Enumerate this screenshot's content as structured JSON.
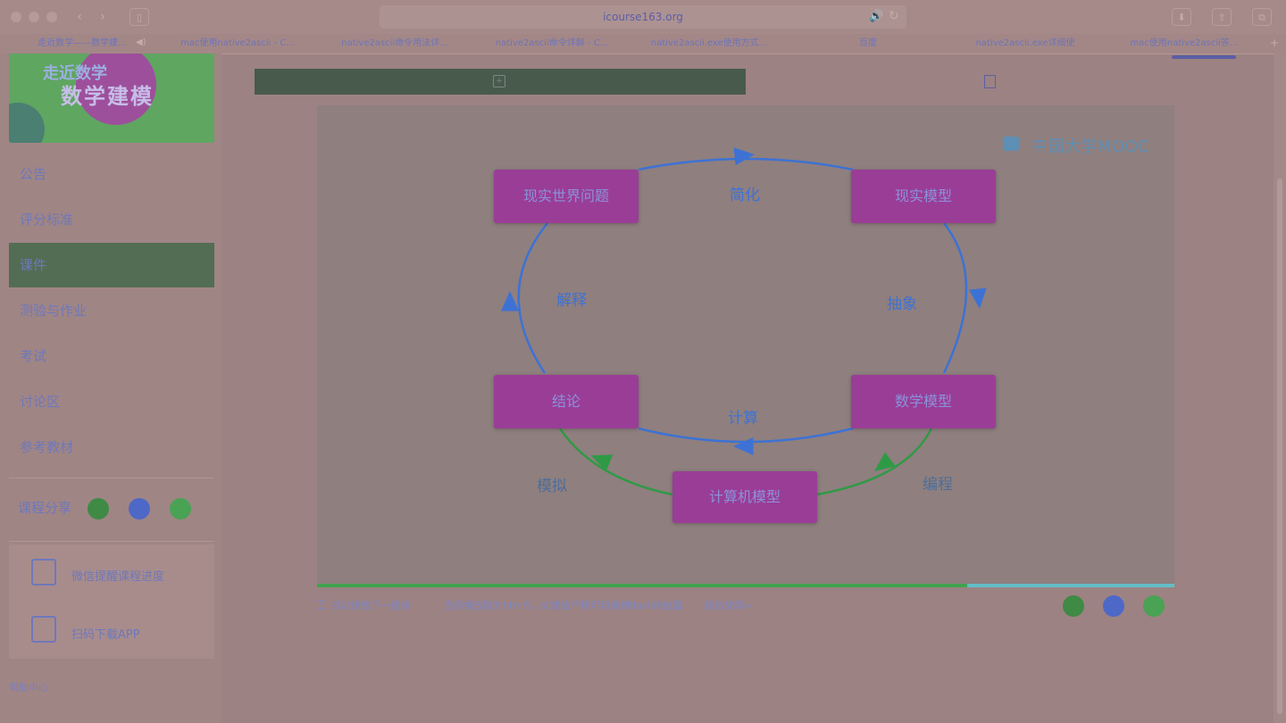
{
  "browser": {
    "url": "icourse163.org",
    "tab_buttons": [
      "‹",
      "›"
    ],
    "bookmarks": [
      "走近数学——数学建...",
      "mac使用native2ascii - C...",
      "native2ascii命令用法详...",
      "native2ascii命令详解 - C...",
      "native2ascii.exe使用方式...",
      "百度",
      "native2ascii.exe详细使",
      "mac使用native2ascii答..."
    ]
  },
  "sidebar": {
    "banner_line1": "走近数学",
    "banner_line2": "数学建模",
    "nav": [
      {
        "label": "公告"
      },
      {
        "label": "评分标准"
      },
      {
        "label": "课件"
      },
      {
        "label": "测验与作业"
      },
      {
        "label": "考试"
      },
      {
        "label": "讨论区"
      },
      {
        "label": "参考教材"
      }
    ],
    "active_index": 2,
    "share_label": "课程分享",
    "app_rows": [
      {
        "label": "微信提醒课程进度"
      },
      {
        "label": "扫码下载APP"
      }
    ],
    "help": "帮助中心"
  },
  "video": {
    "watermark": "中国大学MOOC",
    "progress": 0.758,
    "diagram": {
      "nodes": [
        {
          "label": "现实世界问题"
        },
        {
          "label": "现实模型"
        },
        {
          "label": "数学模型"
        },
        {
          "label": "计算机模型"
        },
        {
          "label": "结论"
        }
      ],
      "edges": [
        {
          "label": "简化"
        },
        {
          "label": "抽象"
        },
        {
          "label": "计算"
        },
        {
          "label": "解释"
        },
        {
          "label": "编程"
        },
        {
          "label": "模拟"
        }
      ]
    }
  },
  "under_video": {
    "autoplay": "自动播放下一视频",
    "notice": "当前播放器为html5，如播放不畅可切换到flash播放器",
    "report": "报告故障>"
  },
  "colors": {
    "node_fill": "#9a3d97",
    "edge_blue": "#3d72d4",
    "edge_green": "#2f9a45",
    "active_nav": "#526d54"
  }
}
